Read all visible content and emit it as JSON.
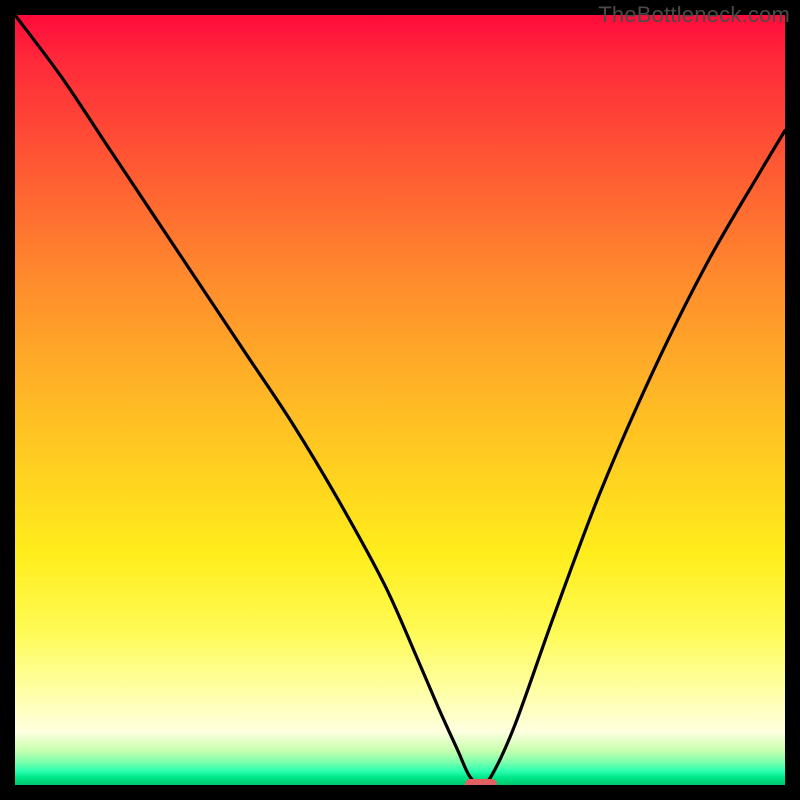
{
  "watermark": "TheBottleneck.com",
  "chart_data": {
    "type": "line",
    "title": "",
    "xlabel": "",
    "ylabel": "",
    "xlim": [
      0,
      100
    ],
    "ylim": [
      0,
      100
    ],
    "series": [
      {
        "name": "bottleneck-curve",
        "x": [
          0,
          6,
          12,
          18,
          24,
          30,
          36,
          42,
          48,
          52,
          55,
          57.5,
          59,
          60.5,
          62,
          65,
          70,
          76,
          83,
          90,
          97,
          100
        ],
        "values": [
          100,
          92,
          83,
          74,
          65,
          56,
          47,
          37,
          26,
          17,
          10,
          4.5,
          1.2,
          0,
          1.4,
          8,
          22,
          38,
          54,
          68,
          80,
          85
        ]
      }
    ],
    "marker": {
      "x": 60.5,
      "y": 0,
      "width_pct": 4.2,
      "height_pct": 1.3,
      "color": "#e2605f"
    },
    "gradient_stops": [
      {
        "pct": 0,
        "color": "#ff0b3a"
      },
      {
        "pct": 34,
        "color": "#ff8a2d"
      },
      {
        "pct": 70,
        "color": "#ffed1c"
      },
      {
        "pct": 93,
        "color": "#ffffe0"
      },
      {
        "pct": 100,
        "color": "#00c76f"
      }
    ]
  }
}
